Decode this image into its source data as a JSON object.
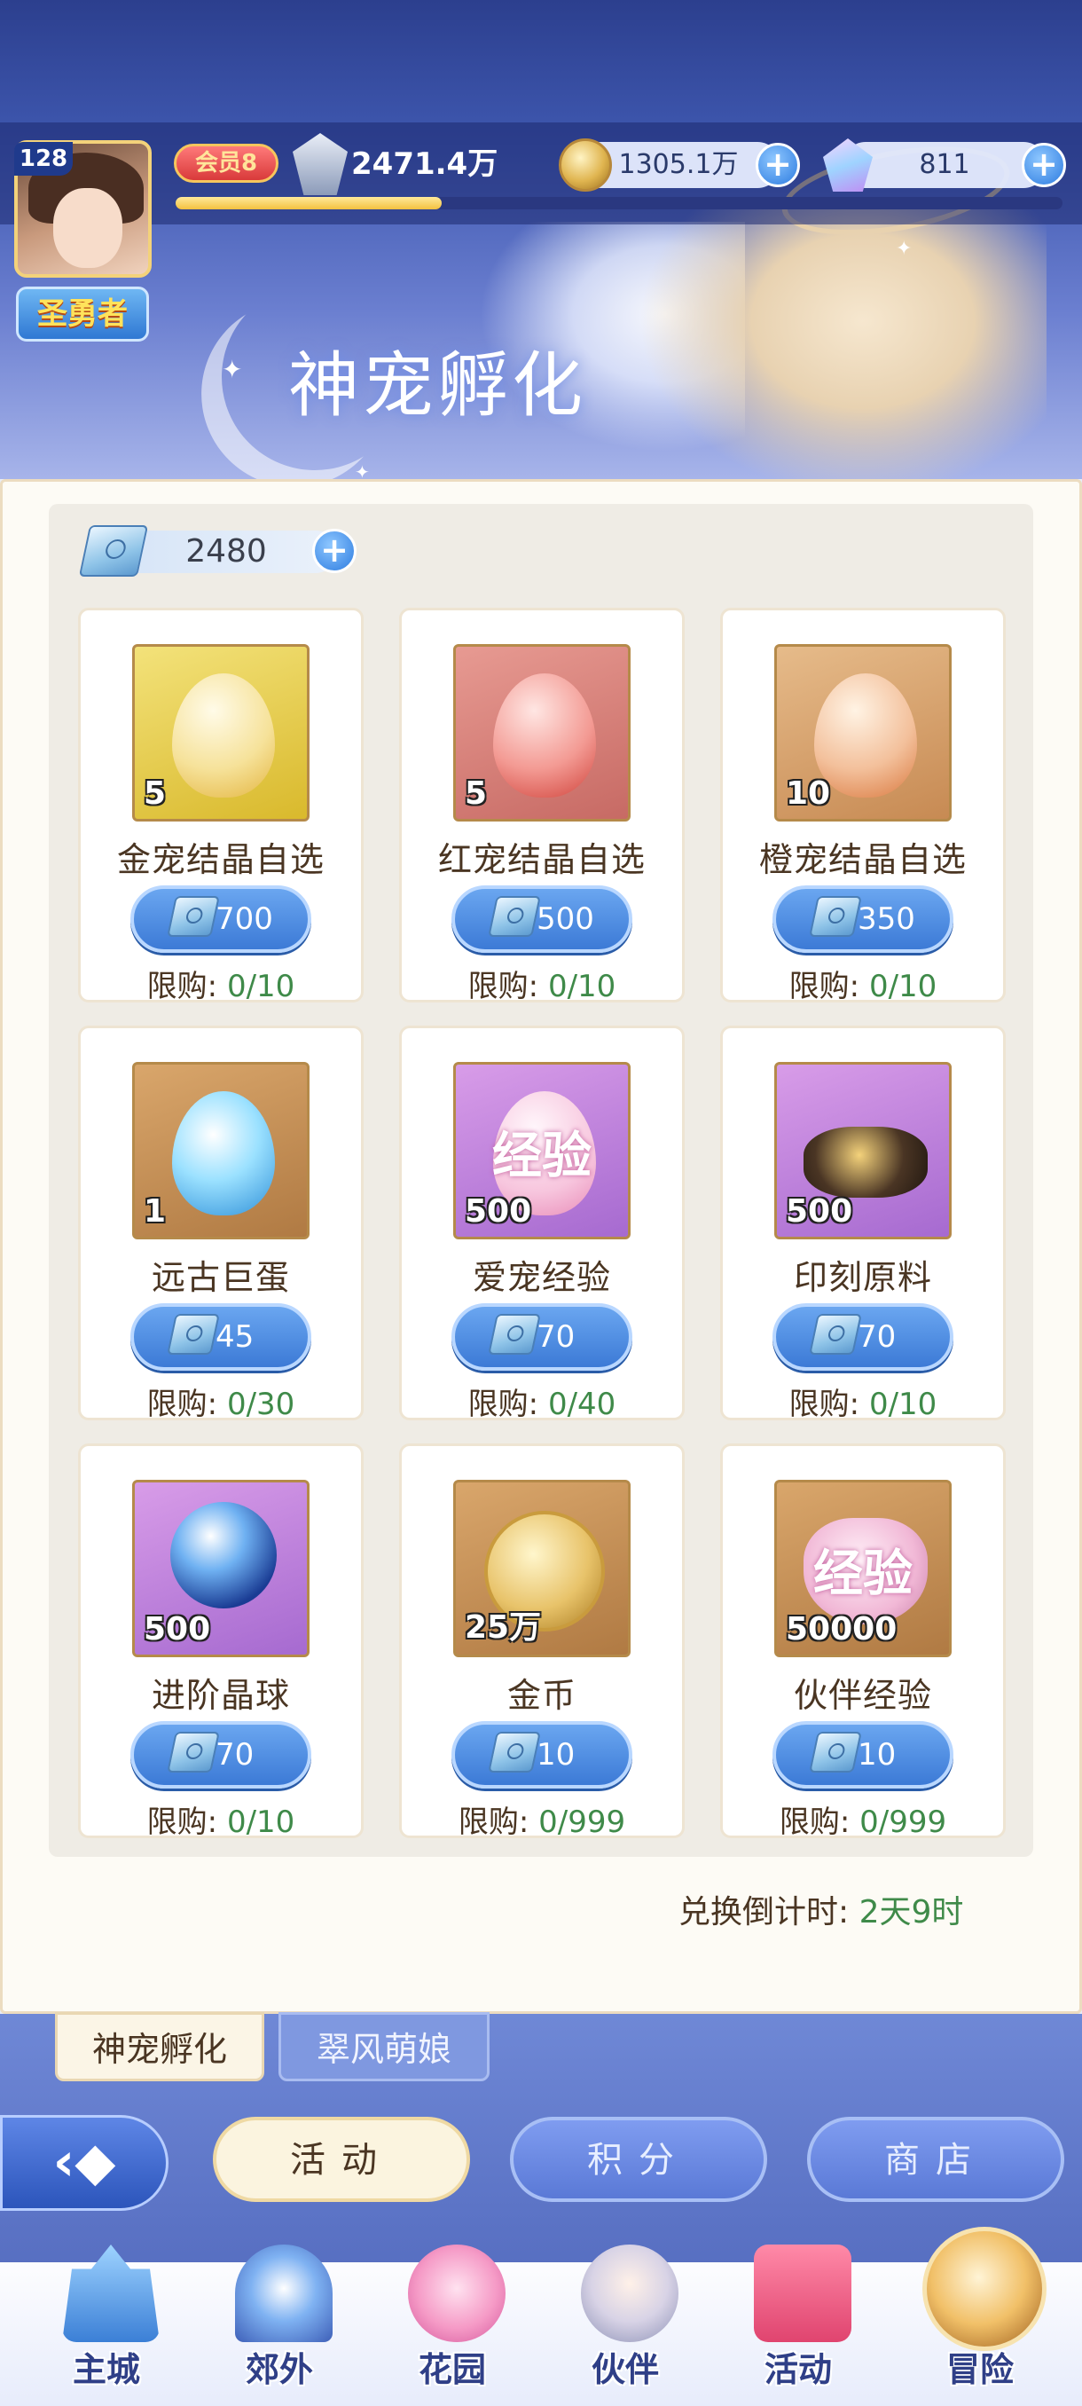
{
  "header": {
    "avatar_level": "128",
    "rank": "圣勇者",
    "vip": "会员8",
    "power": "2471.4万",
    "exp_progress": 0.3,
    "gold": "1305.1万",
    "gems": "811",
    "page_title": "神宠孵化"
  },
  "shop": {
    "ticket_count": "2480",
    "limit_label": "限购:",
    "items": [
      {
        "name": "金宠结晶自选",
        "qty": "5",
        "price": "700",
        "limit": "0/10"
      },
      {
        "name": "红宠结晶自选",
        "qty": "5",
        "price": "500",
        "limit": "0/10"
      },
      {
        "name": "橙宠结晶自选",
        "qty": "10",
        "price": "350",
        "limit": "0/10"
      },
      {
        "name": "远古巨蛋",
        "qty": "1",
        "price": "45",
        "limit": "0/30"
      },
      {
        "name": "爱宠经验",
        "qty": "500",
        "price": "70",
        "limit": "0/40",
        "overlay": "经验"
      },
      {
        "name": "印刻原料",
        "qty": "500",
        "price": "70",
        "limit": "0/10"
      },
      {
        "name": "进阶晶球",
        "qty": "500",
        "price": "70",
        "limit": "0/10"
      },
      {
        "name": "金币",
        "qty": "25万",
        "price": "10",
        "limit": "0/999"
      },
      {
        "name": "伙伴经验",
        "qty": "50000",
        "price": "10",
        "limit": "0/999",
        "overlay": "经验"
      }
    ],
    "countdown_label": "兑换倒计时:",
    "countdown_value": "2天9时"
  },
  "sub_tabs": [
    "神宠孵化",
    "翠风萌娘"
  ],
  "mode_buttons": [
    "活动",
    "积分",
    "商店"
  ],
  "nav": [
    "主城",
    "郊外",
    "花园",
    "伙伴",
    "活动",
    "冒险"
  ],
  "colors": {
    "accent_blue": "#3c7ad6",
    "limit_green": "#3f8a49",
    "text_brown": "#4a3522"
  },
  "icons": {
    "back": "back-arrow-icon",
    "ticket": "book-ticket-icon",
    "gold": "gold-coin-icon",
    "gem": "crystal-gem-icon",
    "power": "wing-crest-icon"
  }
}
